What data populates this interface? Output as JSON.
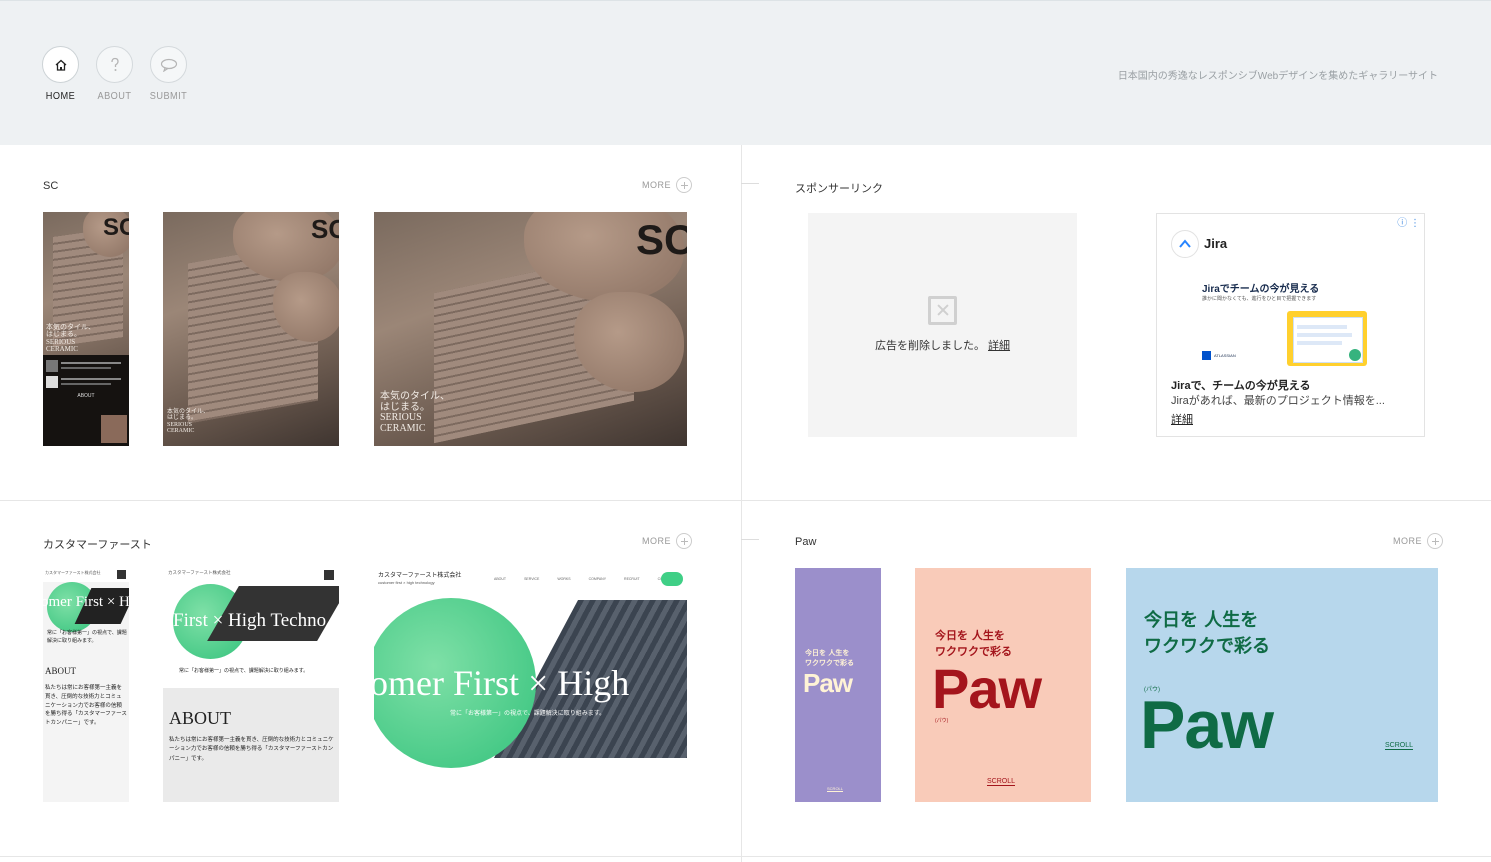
{
  "nav": {
    "items": [
      {
        "label": "HOME",
        "icon": "home-icon",
        "active": true
      },
      {
        "label": "ABOUT",
        "icon": "question-icon",
        "active": false
      },
      {
        "label": "SUBMIT",
        "icon": "speech-bubble-icon",
        "active": false
      }
    ],
    "tagline": "日本国内の秀逸なレスポンシブWebデザインを集めたギャラリーサイト"
  },
  "sections": {
    "sc": {
      "title": "SC",
      "more": "MORE",
      "copy": {
        "line1": "本気のタイル、",
        "line2": "はじまる。",
        "line3": "SERIOUS",
        "line4": "CERAMIC"
      },
      "logo": "SC",
      "about": "ABOUT"
    },
    "sponsor": {
      "title": "スポンサーリンク",
      "removed_message": "広告を削除しました。",
      "removed_link": "詳細",
      "jira": {
        "brand": "Jira",
        "headline_image": "Jiraでチームの今が見える",
        "subline_image": "誰かに聞かなくても、進行をひと目で把握できます",
        "atlassian": "ATLASSIAN",
        "title": "Jiraで、チームの今が見える",
        "body": "Jiraがあれば、最新のプロジェクト情報を...",
        "link": "詳細"
      }
    },
    "customer_first": {
      "title": "カスタマーファースト",
      "more": "MORE",
      "company": "カスタマーファースト株式会社",
      "company_en": "customer first × high technology",
      "hero_words": "omer First × High",
      "hero_words_tablet": "First × High Techno",
      "tagline": "常に「お客様第一」の視点で、課題解決に取り組みます。",
      "about": "ABOUT",
      "about_body": "私たちは常にお客様第一主義を貫き、圧倒的な技術力とコミュニケーション力でお客様の信頼を勝ち得る「カスタマーファーストカンパニー」です。",
      "nav_items": [
        "ABOUT",
        "SERVICE",
        "WORKS",
        "COMPANY",
        "RECRUIT",
        "CONTACT"
      ]
    },
    "paw": {
      "title": "Paw",
      "more": "MORE",
      "jp_line1": "今日を 人生を",
      "jp_line2": "ワクワクで彩る",
      "brand": "Paw",
      "kana": "(パウ)",
      "scroll": "SCROLL"
    }
  },
  "colors": {
    "header_bg": "#eef1f3",
    "paw_purple": "#9b8fcb",
    "paw_pink": "#f9cbb9",
    "paw_blue": "#b7d7ec",
    "paw_green": "#0f6b45",
    "paw_red": "#a4151c",
    "cf_green": "#3fcf86"
  }
}
